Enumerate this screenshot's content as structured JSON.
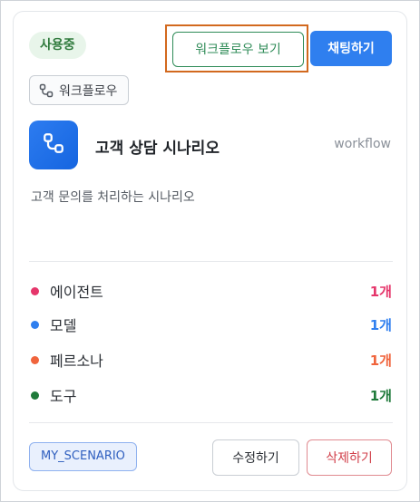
{
  "card": {
    "status_badge": "사용중",
    "view_workflow_button": "워크플로우 보기",
    "chat_button": "채팅하기",
    "type_chip": {
      "label": "워크플로우",
      "icon": "workflow-icon"
    },
    "app_icon": "workflow-icon",
    "title": "고객 상담 시나리오",
    "type_label": "workflow",
    "description": "고객 문의를 처리하는 시나리오",
    "resources": [
      {
        "label": "에이전트",
        "count": "1개",
        "color": "#e5366b"
      },
      {
        "label": "모델",
        "count": "1개",
        "color": "#2f7fef"
      },
      {
        "label": "페르소나",
        "count": "1개",
        "color": "#f0643c"
      },
      {
        "label": "도구",
        "count": "1개",
        "color": "#1f7a3a"
      }
    ],
    "code_chip": "MY_SCENARIO",
    "edit_button": "수정하기",
    "delete_button": "삭제하기"
  },
  "colors": {
    "primary": "#2f7fef",
    "success": "#2e8b57",
    "danger": "#d13f4a",
    "highlight": "#d2691e"
  }
}
